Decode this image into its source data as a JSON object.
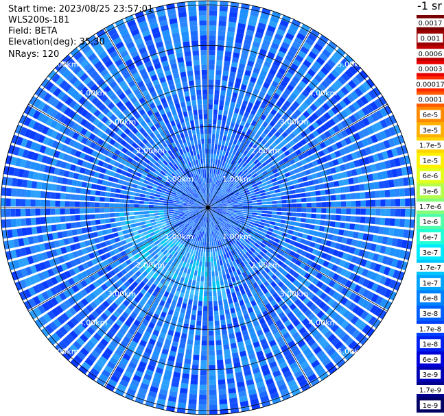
{
  "info": {
    "start_time": "Start time: 2023/08/25 23:57:01",
    "device": "WLS200s-181",
    "field": "Field: BETA",
    "elevation": "Elevation(deg): 35.30",
    "nrays": "NRays: 120"
  },
  "colorbar": {
    "title": "-1 sr",
    "labels": [
      "0.0017",
      "0.001",
      "0.0006",
      "0.0003",
      "0.00017",
      "0.0001",
      "6e-5",
      "3e-5",
      "1.7e-5",
      "1e-5",
      "6e-6",
      "3e-6",
      "1.7e-6",
      "1e-6",
      "6e-7",
      "3e-7",
      "1.7e-7",
      "1e-7",
      "6e-8",
      "3e-8",
      "1.7e-8",
      "1e-8",
      "6e-9",
      "3e-9",
      "1.7e-9",
      "1e-9"
    ],
    "colors": [
      "#7a0000",
      "#9a0000",
      "#c00000",
      "#e80000",
      "#ff2a00",
      "#ff5a00",
      "#ff8a00",
      "#ffb000",
      "#ffd400",
      "#fff000",
      "#e4ff1a",
      "#b4ff4a",
      "#84ff7a",
      "#50ffaa",
      "#20ffd6",
      "#00eaff",
      "#00c6ff",
      "#00a4ff",
      "#0082ff",
      "#0060ff",
      "#0040ff",
      "#0020f0",
      "#0000d8",
      "#0000b4",
      "#00008c",
      "#000064"
    ]
  },
  "chart_data": {
    "type": "heatmap",
    "projection": "polar",
    "n_rays": 120,
    "range_rings_km": [
      1,
      2,
      3,
      4,
      5
    ],
    "ring_labels": [
      "1.00km",
      "2.00km",
      "3.00km",
      "4.00km",
      "5.00km"
    ],
    "max_range_km": 5.1,
    "dominant_color": "#1e90ff"
  }
}
